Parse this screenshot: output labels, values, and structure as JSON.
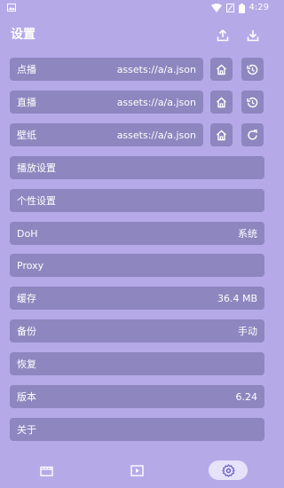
{
  "status": {
    "time": "4:29"
  },
  "header": {
    "title": "设置"
  },
  "rows": [
    {
      "label": "点播",
      "value": "assets://a/a.json"
    },
    {
      "label": "直播",
      "value": "assets://a/a.json"
    },
    {
      "label": "壁纸",
      "value": "assets://a/a.json"
    },
    {
      "label": "播放设置",
      "value": ""
    },
    {
      "label": "个性设置",
      "value": ""
    },
    {
      "label": "DoH",
      "value": "系统"
    },
    {
      "label": "Proxy",
      "value": ""
    },
    {
      "label": "缓存",
      "value": "36.4 MB"
    },
    {
      "label": "备份",
      "value": "手动"
    },
    {
      "label": "恢复",
      "value": ""
    },
    {
      "label": "版本",
      "value": "6.24"
    },
    {
      "label": "关于",
      "value": ""
    }
  ],
  "icons": {
    "header": [
      "upload-icon",
      "download-icon"
    ],
    "row_actions": [
      "home-icon",
      "history-icon",
      "refresh-icon"
    ],
    "nav": [
      "film-icon",
      "play-icon",
      "settings-icon"
    ]
  },
  "colors": {
    "background": "#b5a9e8",
    "row": "#8e86bf",
    "nav_active": "#e6e2fa",
    "active_icon": "#6b5fc7"
  }
}
